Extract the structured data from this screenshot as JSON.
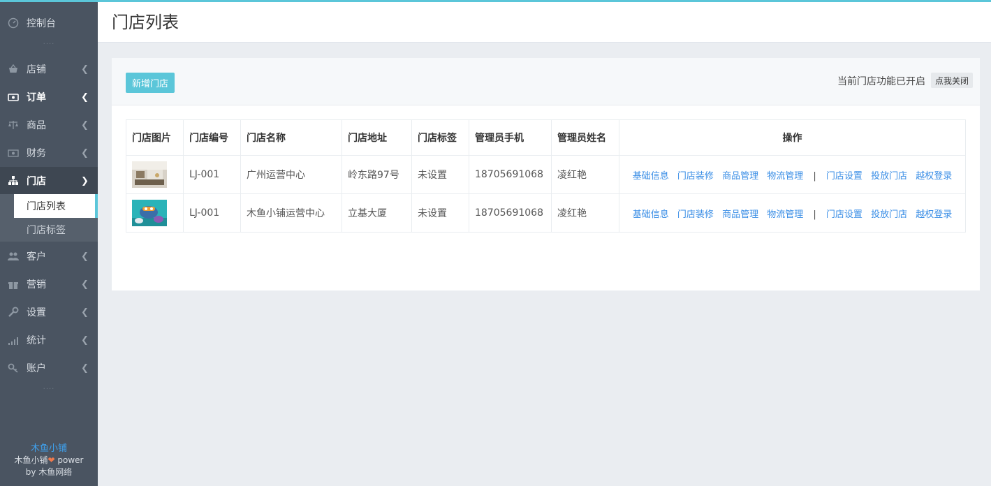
{
  "sidebar": {
    "items": [
      {
        "label": "控制台",
        "icon": "dashboard-icon"
      },
      {
        "label": "店铺",
        "icon": "shop-basket-icon"
      },
      {
        "label": "订单",
        "icon": "money-icon"
      },
      {
        "label": "商品",
        "icon": "scale-icon"
      },
      {
        "label": "财务",
        "icon": "finance-icon"
      },
      {
        "label": "门店",
        "icon": "sitemap-icon"
      },
      {
        "label": "客户",
        "icon": "users-icon"
      },
      {
        "label": "营销",
        "icon": "gift-icon"
      },
      {
        "label": "设置",
        "icon": "wrench-icon"
      },
      {
        "label": "统计",
        "icon": "signal-icon"
      },
      {
        "label": "账户",
        "icon": "key-icon"
      }
    ],
    "submenu": [
      {
        "label": "门店列表",
        "active": true
      },
      {
        "label": "门店标签",
        "active": false
      }
    ],
    "dots": "····",
    "footer": {
      "brand": "木鱼小铺",
      "power_prefix": "木鱼小铺",
      "heart": "❤",
      "power_suffix": " power",
      "by_prefix": "by ",
      "by_name": "木鱼网络"
    }
  },
  "header": {
    "title": "门店列表"
  },
  "toolbar": {
    "add_label": "新增门店",
    "status_text": "当前门店功能已开启",
    "close_label": "点我关闭"
  },
  "table": {
    "headers": [
      "门店图片",
      "门店编号",
      "门店名称",
      "门店地址",
      "门店标签",
      "管理员手机",
      "管理员姓名",
      "操作"
    ],
    "rows": [
      {
        "code": "LJ-001",
        "name": "广州运营中心",
        "address": "岭东路97号",
        "tag": "未设置",
        "phone": "18705691068",
        "admin": "凌红艳"
      },
      {
        "code": "LJ-001",
        "name": "木鱼小铺运营中心",
        "address": "立基大厦",
        "tag": "未设置",
        "phone": "18705691068",
        "admin": "凌红艳"
      }
    ],
    "ops": [
      "基础信息",
      "门店装修",
      "商品管理",
      "物流管理",
      "门店设置",
      "投放门店",
      "越权登录"
    ],
    "ops_separator": "|"
  },
  "colors": {
    "accent": "#5bc6d9",
    "sidebar": "#4a5461",
    "link": "#3a8ee6"
  }
}
